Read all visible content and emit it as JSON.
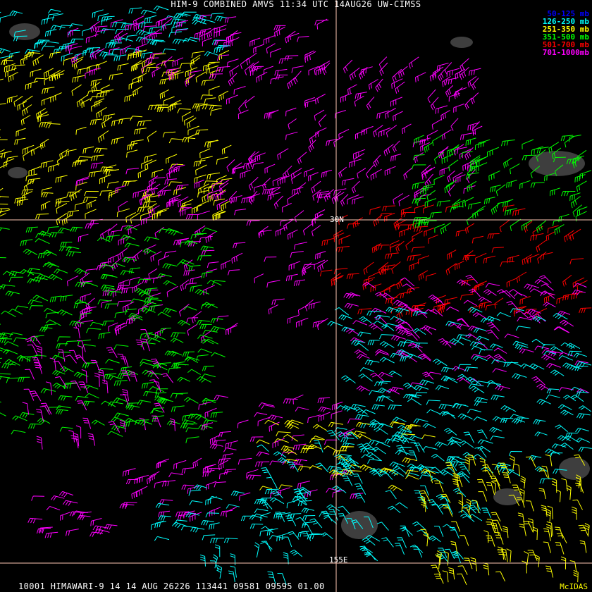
{
  "header": {
    "title": "HIM-9 COMBINED AMVS 11:34 UTC 14AUG26 UW-CIMSS"
  },
  "legend": {
    "items": [
      {
        "label": "50-125 mb",
        "color": "#0000ff"
      },
      {
        "label": "126-250 mb",
        "color": "#00ffff"
      },
      {
        "label": "251-350 mb",
        "color": "#ffff00"
      },
      {
        "label": "351-500 mb",
        "color": "#00ff00"
      },
      {
        "label": "501-700 mb",
        "color": "#ff0000"
      },
      {
        "label": "701-1000mb",
        "color": "#ff00ff"
      }
    ]
  },
  "grid": {
    "lat_label": "30N",
    "lon_label": "155E",
    "line_color": "#ffc8b4"
  },
  "footer": {
    "text": "10001 HIMAWARI-9 14 14 AUG 26226 113441 09581 09595 01.00",
    "credit": "McIDAS"
  }
}
